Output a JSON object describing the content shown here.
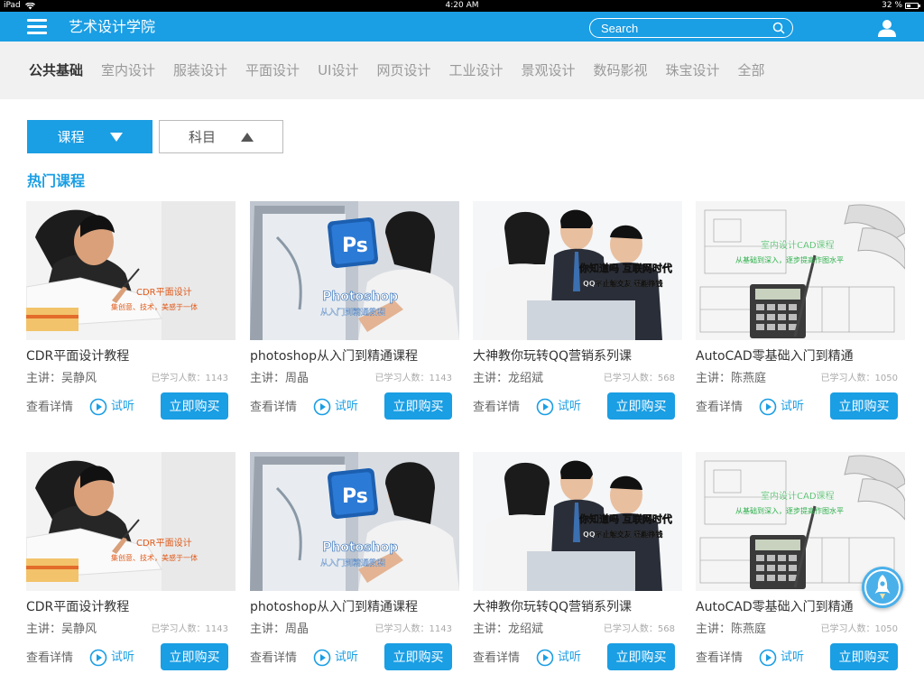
{
  "status_bar": {
    "device": "iPad",
    "time": "4:20 AM",
    "battery": "32 %"
  },
  "header": {
    "title": "艺术设计学院",
    "search_placeholder": "Search"
  },
  "categories": [
    "公共基础",
    "室内设计",
    "服装设计",
    "平面设计",
    "UI设计",
    "网页设计",
    "工业设计",
    "景观设计",
    "数码影视",
    "珠宝设计",
    "全部"
  ],
  "filters": {
    "course": "课程",
    "subject": "科目"
  },
  "section_title": "热门课程",
  "actions": {
    "detail": "查看详情",
    "trial": "试听",
    "buy": "立即购买"
  },
  "thumbs": {
    "cdr": {
      "line1": "CDR平面设计",
      "line2": "集创意、技术，美感于一体"
    },
    "ps": {
      "badge": "Ps",
      "brand": "Photoshop",
      "sub": "从入门到精通教程"
    },
    "qq": {
      "line1": "你知道吗 互联网时代",
      "line2": "QQ不止能交友 还能挣钱"
    },
    "cad": {
      "line1": "室内设计CAD课程",
      "line2": "从基础到深入，逐步提高作图水平"
    }
  },
  "courses": [
    {
      "title": "CDR平面设计教程",
      "teacher": "主讲：吴静风",
      "count": "已学习人数：1143"
    },
    {
      "title": "photoshop从入门到精通课程",
      "teacher": "主讲：周晶",
      "count": "已学习人数：1143"
    },
    {
      "title": "大神教你玩转QQ营销系列课",
      "teacher": "主讲：龙绍斌",
      "count": "已学习人数：568"
    },
    {
      "title": "AutoCAD零基础入门到精通",
      "teacher": "主讲：陈燕庭",
      "count": "已学习人数：1050"
    },
    {
      "title": "CDR平面设计教程",
      "teacher": "主讲：吴静风",
      "count": "已学习人数：1143"
    },
    {
      "title": "photoshop从入门到精通课程",
      "teacher": "主讲：周晶",
      "count": "已学习人数：1143"
    },
    {
      "title": "大神教你玩转QQ营销系列课",
      "teacher": "主讲：龙绍斌",
      "count": "已学习人数：568"
    },
    {
      "title": "AutoCAD零基础入门到精通",
      "teacher": "主讲：陈燕庭",
      "count": "已学习人数：1050"
    }
  ],
  "colors": {
    "accent": "#1a9ee4",
    "nav_bg": "#f1f1f1"
  }
}
